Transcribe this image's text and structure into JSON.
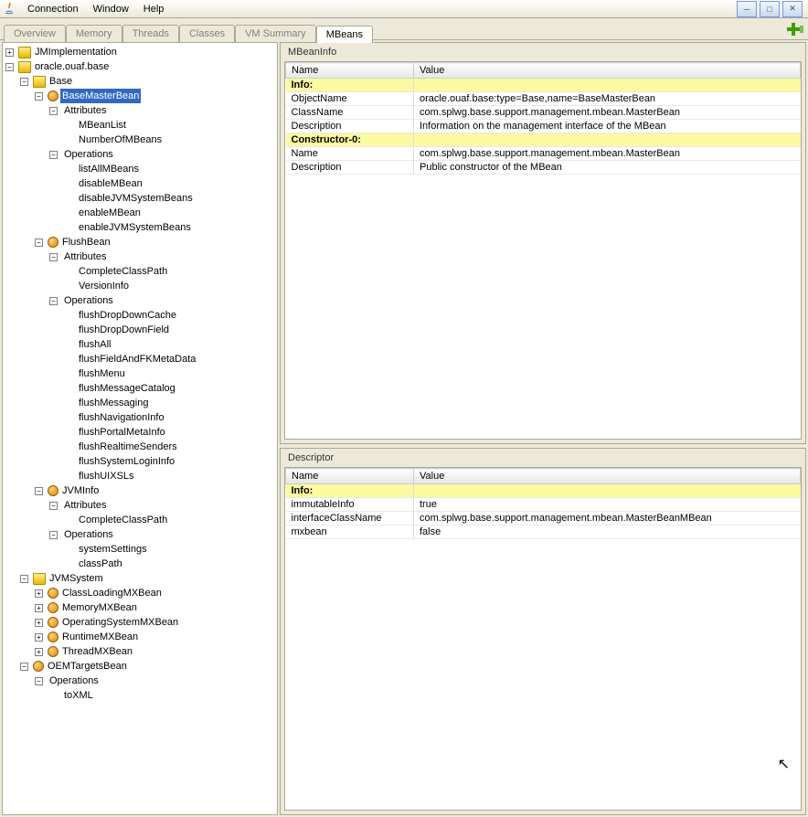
{
  "menu": {
    "items": [
      "Connection",
      "Window",
      "Help"
    ]
  },
  "tabs": {
    "items": [
      {
        "label": "Overview",
        "active": false
      },
      {
        "label": "Memory",
        "active": false
      },
      {
        "label": "Threads",
        "active": false
      },
      {
        "label": "Classes",
        "active": false
      },
      {
        "label": "VM Summary",
        "active": false
      },
      {
        "label": "MBeans",
        "active": true
      }
    ]
  },
  "tree": [
    {
      "label": "JMImplementation",
      "icon": "folder",
      "toggle": "plus",
      "children": []
    },
    {
      "label": "oracle.ouaf.base",
      "icon": "folder",
      "toggle": "minus",
      "children": [
        {
          "label": "Base",
          "icon": "folder",
          "toggle": "minus",
          "children": [
            {
              "label": "BaseMasterBean",
              "icon": "bean",
              "toggle": "minus",
              "selected": true,
              "children": [
                {
                  "label": "Attributes",
                  "icon": "",
                  "toggle": "minus",
                  "children": [
                    {
                      "label": "MBeanList",
                      "icon": "",
                      "toggle": "none"
                    },
                    {
                      "label": "NumberOfMBeans",
                      "icon": "",
                      "toggle": "none"
                    }
                  ]
                },
                {
                  "label": "Operations",
                  "icon": "",
                  "toggle": "minus",
                  "children": [
                    {
                      "label": "listAllMBeans",
                      "icon": "",
                      "toggle": "none"
                    },
                    {
                      "label": "disableMBean",
                      "icon": "",
                      "toggle": "none"
                    },
                    {
                      "label": "disableJVMSystemBeans",
                      "icon": "",
                      "toggle": "none"
                    },
                    {
                      "label": "enableMBean",
                      "icon": "",
                      "toggle": "none"
                    },
                    {
                      "label": "enableJVMSystemBeans",
                      "icon": "",
                      "toggle": "none"
                    }
                  ]
                }
              ]
            },
            {
              "label": "FlushBean",
              "icon": "bean",
              "toggle": "minus",
              "children": [
                {
                  "label": "Attributes",
                  "icon": "",
                  "toggle": "minus",
                  "children": [
                    {
                      "label": "CompleteClassPath",
                      "icon": "",
                      "toggle": "none"
                    },
                    {
                      "label": "VersionInfo",
                      "icon": "",
                      "toggle": "none"
                    }
                  ]
                },
                {
                  "label": "Operations",
                  "icon": "",
                  "toggle": "minus",
                  "children": [
                    {
                      "label": "flushDropDownCache",
                      "icon": "",
                      "toggle": "none"
                    },
                    {
                      "label": "flushDropDownField",
                      "icon": "",
                      "toggle": "none"
                    },
                    {
                      "label": "flushAll",
                      "icon": "",
                      "toggle": "none"
                    },
                    {
                      "label": "flushFieldAndFKMetaData",
                      "icon": "",
                      "toggle": "none"
                    },
                    {
                      "label": "flushMenu",
                      "icon": "",
                      "toggle": "none"
                    },
                    {
                      "label": "flushMessageCatalog",
                      "icon": "",
                      "toggle": "none"
                    },
                    {
                      "label": "flushMessaging",
                      "icon": "",
                      "toggle": "none"
                    },
                    {
                      "label": "flushNavigationInfo",
                      "icon": "",
                      "toggle": "none"
                    },
                    {
                      "label": "flushPortalMetaInfo",
                      "icon": "",
                      "toggle": "none"
                    },
                    {
                      "label": "flushRealtimeSenders",
                      "icon": "",
                      "toggle": "none"
                    },
                    {
                      "label": "flushSystemLoginInfo",
                      "icon": "",
                      "toggle": "none"
                    },
                    {
                      "label": "flushUIXSLs",
                      "icon": "",
                      "toggle": "none"
                    }
                  ]
                }
              ]
            },
            {
              "label": "JVMInfo",
              "icon": "bean",
              "toggle": "minus",
              "children": [
                {
                  "label": "Attributes",
                  "icon": "",
                  "toggle": "minus",
                  "children": [
                    {
                      "label": "CompleteClassPath",
                      "icon": "",
                      "toggle": "none"
                    }
                  ]
                },
                {
                  "label": "Operations",
                  "icon": "",
                  "toggle": "minus",
                  "children": [
                    {
                      "label": "systemSettings",
                      "icon": "",
                      "toggle": "none"
                    },
                    {
                      "label": "classPath",
                      "icon": "",
                      "toggle": "none"
                    }
                  ]
                }
              ]
            }
          ]
        },
        {
          "label": "JVMSystem",
          "icon": "folder",
          "toggle": "minus",
          "children": [
            {
              "label": "ClassLoadingMXBean",
              "icon": "bean",
              "toggle": "plus",
              "children": []
            },
            {
              "label": "MemoryMXBean",
              "icon": "bean",
              "toggle": "plus",
              "children": []
            },
            {
              "label": "OperatingSystemMXBean",
              "icon": "bean",
              "toggle": "plus",
              "children": []
            },
            {
              "label": "RuntimeMXBean",
              "icon": "bean",
              "toggle": "plus",
              "children": []
            },
            {
              "label": "ThreadMXBean",
              "icon": "bean",
              "toggle": "plus",
              "children": []
            }
          ]
        },
        {
          "label": "OEMTargetsBean",
          "icon": "bean",
          "toggle": "minus",
          "children": [
            {
              "label": "Operations",
              "icon": "",
              "toggle": "minus",
              "children": [
                {
                  "label": "toXML",
                  "icon": "",
                  "toggle": "none"
                }
              ]
            }
          ]
        }
      ]
    }
  ],
  "mbeaninfo": {
    "title": "MBeanInfo",
    "headers": {
      "name": "Name",
      "value": "Value"
    },
    "rows": [
      {
        "section": true,
        "name": "Info:",
        "value": ""
      },
      {
        "name": "ObjectName",
        "value": "oracle.ouaf.base:type=Base,name=BaseMasterBean"
      },
      {
        "name": "ClassName",
        "value": "com.splwg.base.support.management.mbean.MasterBean"
      },
      {
        "name": "Description",
        "value": "Information on the management interface of the MBean"
      },
      {
        "section": true,
        "name": "Constructor-0:",
        "value": ""
      },
      {
        "name": "Name",
        "value": "com.splwg.base.support.management.mbean.MasterBean"
      },
      {
        "name": "Description",
        "value": "Public constructor of the MBean"
      }
    ]
  },
  "descriptor": {
    "title": "Descriptor",
    "headers": {
      "name": "Name",
      "value": "Value"
    },
    "rows": [
      {
        "section": true,
        "name": "Info:",
        "value": ""
      },
      {
        "name": "immutableInfo",
        "value": "true"
      },
      {
        "name": "interfaceClassName",
        "value": "com.splwg.base.support.management.mbean.MasterBeanMBean"
      },
      {
        "name": "mxbean",
        "value": "false"
      }
    ]
  }
}
